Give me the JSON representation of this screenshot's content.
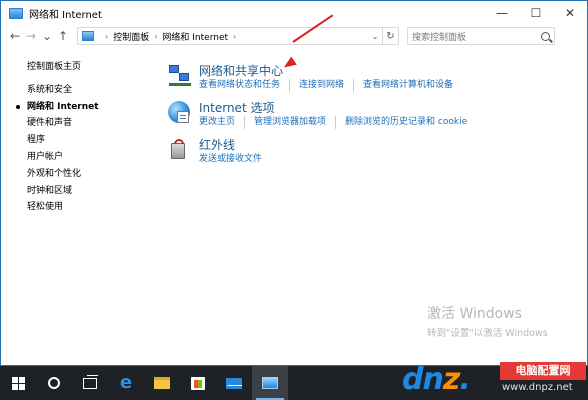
{
  "window": {
    "title": "网络和 Internet",
    "minimize": "—",
    "maximize": "☐",
    "close": "✕"
  },
  "nav": {
    "back": "←",
    "forward": "→",
    "recent": "⌄",
    "up": "↑",
    "breadcrumbs": [
      "控制面板",
      "网络和 Internet"
    ],
    "separator": "›",
    "dropdown": "⌄",
    "refresh": "↻",
    "search_placeholder": "搜索控制面板"
  },
  "sidebar": {
    "items": [
      {
        "label": "控制面板主页"
      },
      {
        "label": "系统和安全"
      },
      {
        "label": "网络和 Internet"
      },
      {
        "label": "硬件和声音"
      },
      {
        "label": "程序"
      },
      {
        "label": "用户帐户"
      },
      {
        "label": "外观和个性化"
      },
      {
        "label": "时钟和区域"
      },
      {
        "label": "轻松使用"
      }
    ],
    "active_index": 2
  },
  "main": {
    "categories": [
      {
        "title": "网络和共享中心",
        "icon": "network-icon",
        "links": [
          "查看网络状态和任务",
          "连接到网络",
          "查看网络计算机和设备"
        ]
      },
      {
        "title": "Internet 选项",
        "icon": "internet-options-icon",
        "links": [
          "更改主页",
          "管理浏览器加载项",
          "删除浏览的历史记录和 cookie"
        ]
      },
      {
        "title": "红外线",
        "icon": "infrared-icon",
        "links": [
          "发送或接收文件"
        ]
      }
    ]
  },
  "activation": {
    "line1": "激活 Windows",
    "line2": "转到\"设置\"以激活 Windows"
  },
  "taskbar": {
    "edge_glyph": "e",
    "items": [
      "start-icon",
      "cortana-icon",
      "task-view-icon",
      "edge-icon",
      "file-explorer-icon",
      "store-icon",
      "mail-icon",
      "control-panel-icon"
    ]
  },
  "brand": {
    "logo_a": "dn",
    "logo_b": "z",
    "logo_c": ".",
    "badge": "电脑配置网",
    "url": "www.dnpz.net"
  },
  "colors": {
    "link": "#1e6fb5",
    "category_title": "#1c5a91",
    "annotation_arrow": "#dd2222",
    "taskbar": "#1e2226"
  }
}
